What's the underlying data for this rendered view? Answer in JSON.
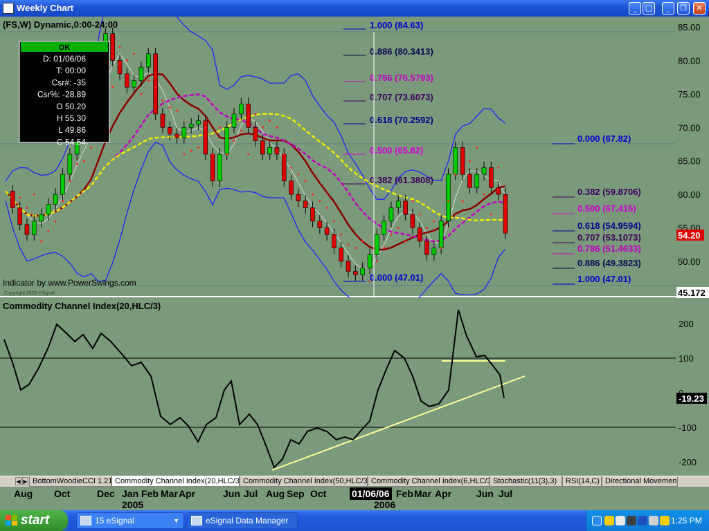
{
  "window": {
    "title": "Weekly Chart",
    "buttons": {
      "min": "_",
      "max": "□",
      "inner_min": "_",
      "restore": "❐",
      "close": "✕"
    }
  },
  "chart": {
    "header": "(FS,W) Dynamic,0:00-24:00",
    "infobox": {
      "status": "OK",
      "rows": [
        "D: 01/06/06",
        "T: 00:00",
        "Csr#: -35",
        "Csr%: -28.89",
        "O 50.20",
        "H 55.30",
        "L 49.86",
        "C 54.54"
      ]
    },
    "credit": "Indicator by www.PowerSwings.com",
    "copyright": "Copyright 2005 eSignal",
    "price_axis": [
      "85.00",
      "80.00",
      "75.00",
      "70.00",
      "65.00",
      "60.00",
      "55.00",
      "50.00"
    ],
    "last_price": "54.20",
    "cursor_price": "45.172",
    "fib_left": [
      {
        "label": "1.000 (84.63)",
        "color": "#0000cc"
      },
      {
        "label": "0.886 (80.3413)",
        "color": "#0a0a50"
      },
      {
        "label": "0.786 (76.5793)",
        "color": "#c000c0"
      },
      {
        "label": "0.707 (73.6073)",
        "color": "#3a005a"
      },
      {
        "label": "0.618 (70.2592)",
        "color": "#00008a"
      },
      {
        "label": "0.500 (65.82)",
        "color": "#d000d0"
      },
      {
        "label": "0.382 (61.3808)",
        "color": "#3a005a"
      },
      {
        "label": "0.000 (47.01)",
        "color": "#0000cc"
      }
    ],
    "fib_right": [
      {
        "label": "0.000 (67.82)",
        "color": "#0000cc"
      },
      {
        "label": "0.382 (59.8706)",
        "color": "#3a005a"
      },
      {
        "label": "0.500 (57.415)",
        "color": "#d000d0"
      },
      {
        "label": "0.618 (54.9594)",
        "color": "#00008a"
      },
      {
        "label": "0.707 (53.1073)",
        "color": "#3a005a"
      },
      {
        "label": "0.786 (51.4633)",
        "color": "#c000c0"
      },
      {
        "label": "0.886 (49.3823)",
        "color": "#0a0a50"
      },
      {
        "label": "1.000 (47.01)",
        "color": "#0000cc"
      }
    ]
  },
  "cci": {
    "header": "Commodity Channel Index(20,HLC/3)",
    "axis": [
      "200",
      "100",
      "0",
      "-100",
      "-200"
    ],
    "last_value": "-19.23"
  },
  "tabs": [
    {
      "label": "BottomWoodieCCI 1.21",
      "active": false
    },
    {
      "label": "Commodity Channel Index(20,HLC/3)",
      "active": true
    },
    {
      "label": "Commodity Channel Index(50,HLC/3)",
      "active": false
    },
    {
      "label": "Commodity Channel Index(6,HLC/3)",
      "active": false
    },
    {
      "label": "Stochastic(11(3),3)",
      "active": false
    },
    {
      "label": "RSI(14,C)",
      "active": false
    },
    {
      "label": "Directional Movement",
      "active": false
    }
  ],
  "date_axis": {
    "months": [
      "Aug",
      "Oct",
      "Dec",
      "Jan",
      "Feb",
      "Mar",
      "Apr",
      "Jun",
      "Jul",
      "Aug",
      "Sep",
      "Oct",
      "Feb",
      "Mar",
      "Apr",
      "Jun",
      "Jul"
    ],
    "years": [
      "2005",
      "2006"
    ],
    "cursor_date": "01/06/06"
  },
  "taskbar": {
    "start": "start",
    "items": [
      {
        "label": "15 eSignal"
      },
      {
        "label": "eSignal Data Manager"
      }
    ],
    "clock": "1:25 PM"
  },
  "colors": {
    "background": "#7b9a7b",
    "up_candle": "#00cc00",
    "down_candle": "#dd0000",
    "bollinger": "#1a1aff",
    "ma_fast": "#8b0000",
    "ma_mid": "#c000c0",
    "ma_slow": "#f0f000",
    "parabolic": "#ff2020",
    "cci_line": "#000000",
    "trendline": "#ffff99"
  },
  "chart_data": {
    "type": "candlestick",
    "timeframe": "weekly",
    "symbol": "FS",
    "weeks": 62,
    "close_approx": [
      60.5,
      58,
      55.5,
      54,
      56,
      57,
      58.5,
      60,
      63,
      66,
      68.5,
      69,
      71,
      82,
      84,
      80,
      78,
      76,
      77,
      79,
      81,
      72,
      70,
      69,
      68.5,
      70,
      70.5,
      71,
      66,
      62,
      66,
      70,
      72,
      73.5,
      70,
      68,
      66,
      67,
      66,
      62,
      60,
      59,
      58,
      56,
      55,
      54,
      52,
      50,
      48.5,
      48,
      49,
      51,
      54,
      56,
      58,
      59,
      57,
      55,
      53,
      51,
      52,
      56,
      63,
      67,
      63,
      61,
      63,
      64,
      61,
      60,
      54.2
    ]
  }
}
